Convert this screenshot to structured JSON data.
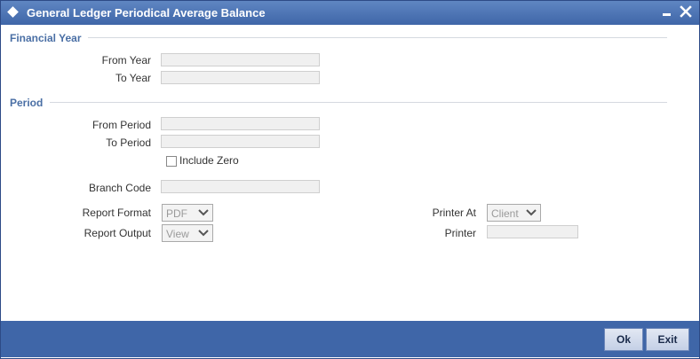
{
  "window": {
    "title": "General Ledger Periodical Average Balance"
  },
  "financial_year": {
    "section_label": "Financial Year",
    "from_year_label": "From Year",
    "from_year_value": "",
    "to_year_label": "To Year",
    "to_year_value": ""
  },
  "period": {
    "section_label": "Period",
    "from_period_label": "From Period",
    "from_period_value": "",
    "to_period_label": "To Period",
    "to_period_value": "",
    "include_zero_label": "Include Zero",
    "include_zero_checked": false
  },
  "branch": {
    "label": "Branch Code",
    "value": ""
  },
  "report": {
    "format_label": "Report Format",
    "format_value": "PDF",
    "output_label": "Report Output",
    "output_value": "View",
    "printer_at_label": "Printer At",
    "printer_at_value": "Client",
    "printer_label": "Printer",
    "printer_value": ""
  },
  "buttons": {
    "ok": "Ok",
    "exit": "Exit"
  },
  "colors": {
    "titlebar": "#4a72b4",
    "footer": "#3f66a8",
    "section_text": "#4a6fa5"
  }
}
